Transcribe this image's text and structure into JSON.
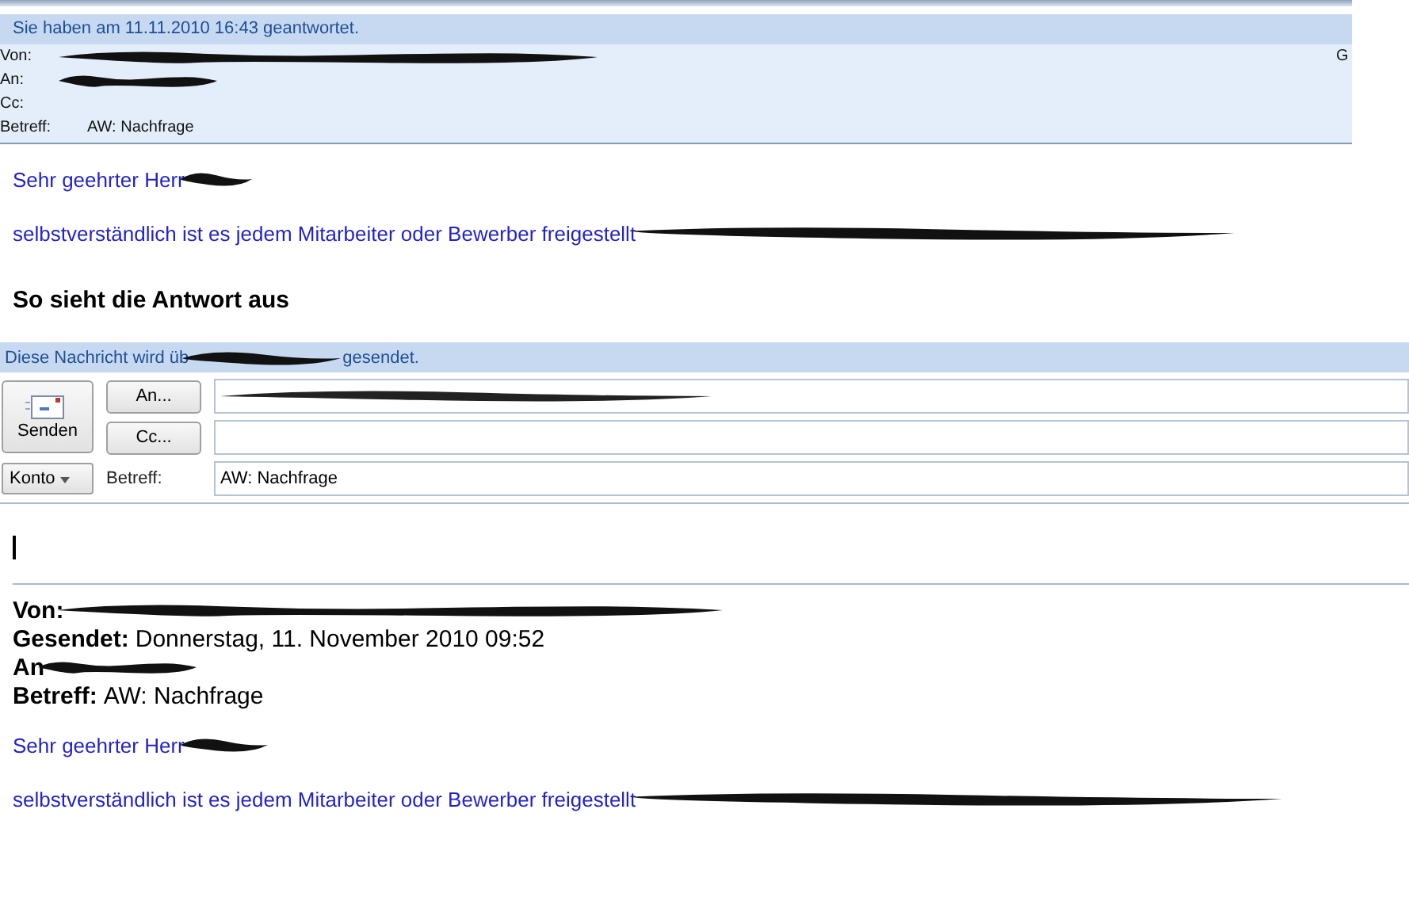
{
  "reply_notice": {
    "text": "Sie haben am 11.11.2010 16:43 geantwortet."
  },
  "original_header": {
    "right_cut": "G",
    "fields": [
      {
        "label": "Von:"
      },
      {
        "label": "An:"
      },
      {
        "label": "Cc:"
      },
      {
        "label": "Betreff:",
        "value": "AW: Nachfrage"
      }
    ]
  },
  "original_body": {
    "greeting": "Sehr geehrter Herr",
    "text": "selbstverständlich ist es jedem Mitarbeiter oder Bewerber freigestellt"
  },
  "heading": "So sieht die Antwort aus",
  "compose": {
    "notice_start": "Diese Nachricht wird üb",
    "notice_end": "gesendet.",
    "send_button": "Senden",
    "to_button": "An...",
    "cc_button": "Cc...",
    "account_button": "Konto",
    "subject_label": "Betreff:",
    "subject_value": "AW: Nachfrage",
    "to_redacted": true
  },
  "quoted": {
    "fields": [
      {
        "label": "Von:"
      },
      {
        "label": "Gesendet:",
        "value": "Donnerstag, 11. November 2010 09:52"
      },
      {
        "label": "An"
      },
      {
        "label": "Betreff:",
        "value": "AW: Nachfrage"
      }
    ],
    "greeting": "Sehr geehrter Herr",
    "text": "selbstverständlich ist es jedem Mitarbeiter oder Bewerber freigestellt"
  }
}
